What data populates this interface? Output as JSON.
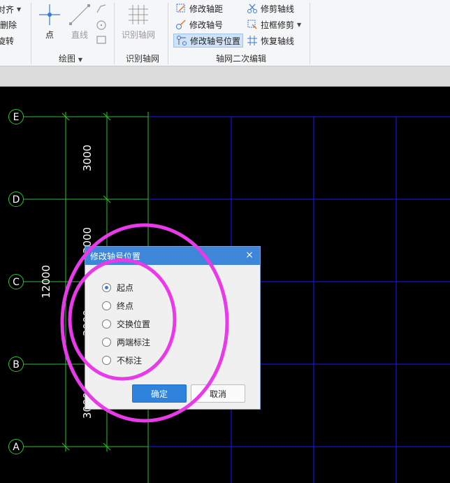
{
  "ribbon": {
    "left_partial": {
      "align": "对齐",
      "delete": "删除",
      "rotate": "旋转"
    },
    "draw_group": {
      "label": "绘图",
      "point": "点",
      "line": "直线"
    },
    "identify_group": {
      "label": "识别轴网",
      "button": "识别轴网"
    },
    "edit_group": {
      "label": "轴网二次编辑",
      "modify_distance": "修改轴距",
      "modify_number": "修改轴号",
      "modify_number_position": "修改轴号位置",
      "trim_axis": "修剪轴线",
      "box_trim": "拉框修剪",
      "restore_axis": "恢复轴线"
    }
  },
  "canvas": {
    "axis_labels": [
      "E",
      "D",
      "C",
      "B",
      "A"
    ],
    "dimensions": {
      "segment_1": "3000",
      "segment_2": "3000",
      "segment_3": "3000",
      "segment_4": "3000",
      "total": "12000"
    },
    "colors": {
      "background": "#000000",
      "grid": "#1a1aff",
      "dimension": "#2fbf2f",
      "highlight": "#e83ae8"
    }
  },
  "dialog": {
    "title": "修改轴号位置",
    "options": [
      {
        "label": "起点",
        "checked": true
      },
      {
        "label": "终点",
        "checked": false
      },
      {
        "label": "交换位置",
        "checked": false
      },
      {
        "label": "两端标注",
        "checked": false
      },
      {
        "label": "不标注",
        "checked": false
      }
    ],
    "ok_label": "确定",
    "cancel_label": "取消"
  }
}
